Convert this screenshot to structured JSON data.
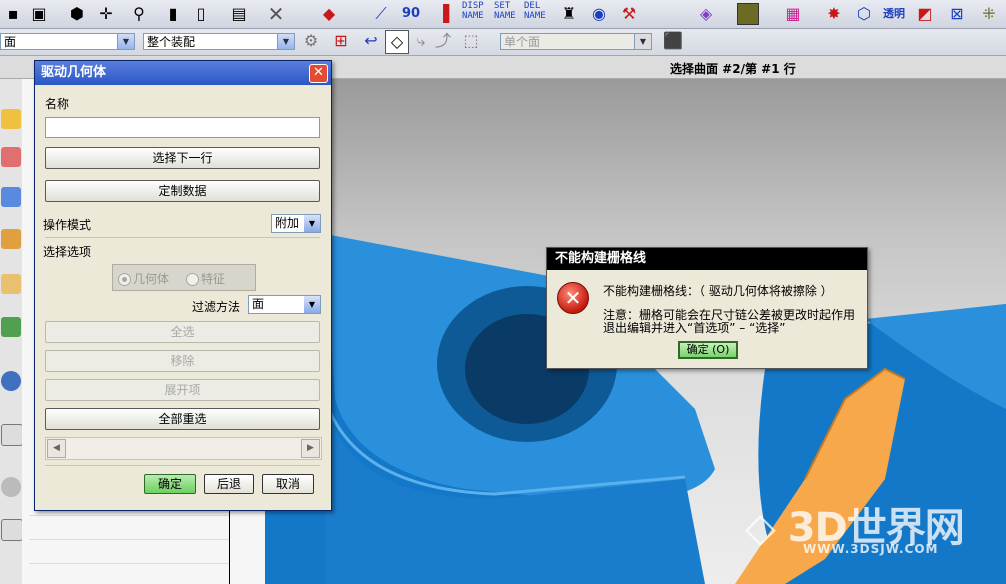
{
  "toolbar": {
    "disp_label": "DISP",
    "set_label": "SET",
    "del_label": "DEL",
    "name_label_1": "NAME",
    "name_label_2": "NAME",
    "name_label_3": "NAME",
    "angle_label": "90",
    "transparent_label": "透明"
  },
  "toolbar2": {
    "filter_combo": "面",
    "assembly_combo": "整个装配",
    "selection_combo": "单个面"
  },
  "status": {
    "prompt": "选择曲面 #2/第 #1 行"
  },
  "dialog": {
    "title": "驱动几何体",
    "name_label": "名称",
    "name_value": "",
    "select_next_row": "选择下一行",
    "custom_data": "定制数据",
    "op_mode_label": "操作模式",
    "op_mode_value": "附加",
    "select_options_label": "选择选项",
    "radio_geometry": "几何体",
    "radio_feature": "特征",
    "filter_method_label": "过滤方法",
    "filter_method_value": "面",
    "select_all": "全选",
    "remove": "移除",
    "expand_items": "展开项",
    "reselect_all": "全部重选",
    "ok": "确定",
    "back": "后退",
    "cancel": "取消"
  },
  "error": {
    "title": "不能构建栅格线",
    "line1": "不能构建栅格线：（ 驱动几何体将被擦除 ）",
    "line2": "注意：栅格可能会在尺寸链公差被更改时起作用",
    "line3": "退出编辑并进入“首选项” – “选择”",
    "ok": "确定 (O)"
  },
  "watermark": {
    "logo": "3D世界网",
    "url": "WWW.3DSJW.COM"
  }
}
